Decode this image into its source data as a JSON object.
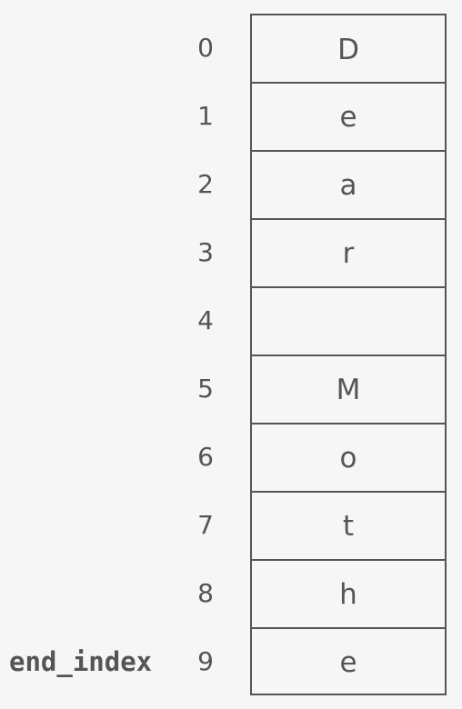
{
  "indices": [
    "0",
    "1",
    "2",
    "3",
    "4",
    "5",
    "6",
    "7",
    "8",
    "9"
  ],
  "cells": [
    "D",
    "e",
    "a",
    "r",
    " ",
    "M",
    "o",
    "t",
    "h",
    "e"
  ],
  "pointer_label": "end_index",
  "colors": {
    "background": "#f6f6f6",
    "stroke": "#555555",
    "text": "#555555"
  }
}
